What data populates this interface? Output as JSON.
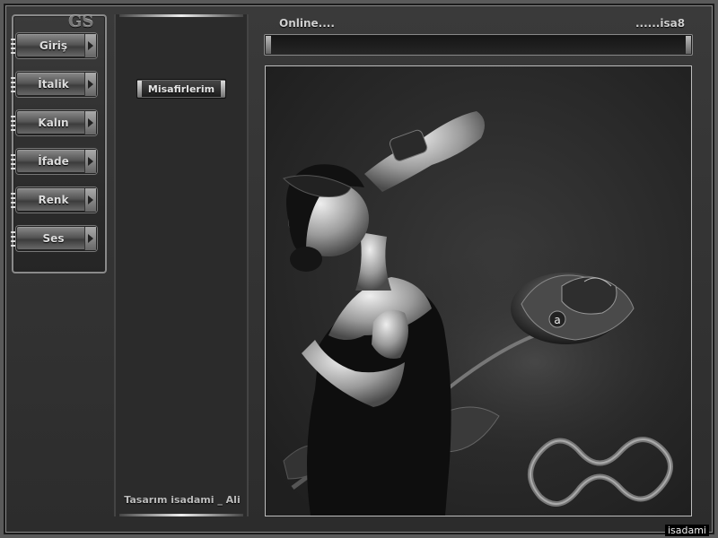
{
  "logo": "GS",
  "menu": {
    "items": [
      {
        "id": "giris",
        "label": "Giriş"
      },
      {
        "id": "italik",
        "label": "İtalik"
      },
      {
        "id": "kalin",
        "label": "Kalın"
      },
      {
        "id": "ifade",
        "label": "İfade"
      },
      {
        "id": "renk",
        "label": "Renk"
      },
      {
        "id": "ses",
        "label": "Ses"
      }
    ]
  },
  "guest_button": "Misafirlerim",
  "footer_credit": "Tasarım  isadami _ Ali",
  "header": {
    "online": "Online....",
    "ticker": "......isa8"
  },
  "watermark": "isadami",
  "rose_badge": "a",
  "colors": {
    "background": "#2c2c2c",
    "frame": "#5a5a5a",
    "button": "#6a6a6a"
  }
}
